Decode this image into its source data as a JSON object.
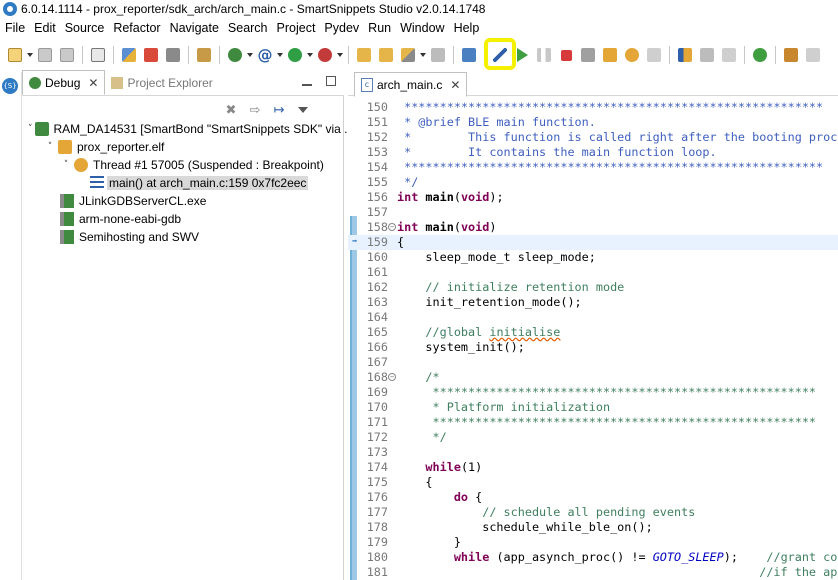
{
  "window": {
    "title": "6.0.14.1114 - prox_reporter/sdk_arch/arch_main.c - SmartSnippets Studio v2.0.14.1748"
  },
  "menu": [
    "File",
    "Edit",
    "Source",
    "Refactor",
    "Navigate",
    "Search",
    "Project",
    "Pydev",
    "Run",
    "Window",
    "Help"
  ],
  "colors": {
    "highlight": "#f5f000",
    "accent": "#2e7bc4",
    "comment": "#3f7f5f",
    "keyword": "#7f0055",
    "current_line": "#e8f2fe"
  },
  "debug_panel": {
    "tabs": [
      {
        "label": "Debug",
        "icon": "debug-icon",
        "active": true
      },
      {
        "label": "Project Explorer",
        "icon": "project-explorer-icon",
        "active": false
      }
    ],
    "tree": [
      {
        "label": "RAM_DA14531 [SmartBond \"SmartSnippets SDK\" via ...",
        "icon": "debug-launch-icon",
        "depth": 0,
        "expanded": true
      },
      {
        "label": "prox_reporter.elf",
        "icon": "elf-file-icon",
        "depth": 1,
        "expanded": true
      },
      {
        "label": "Thread #1 57005 (Suspended : Breakpoint)",
        "icon": "thread-icon",
        "depth": 2,
        "expanded": true
      },
      {
        "label": "main() at arch_main.c:159 0x7fc2eec",
        "icon": "stack-frame-icon",
        "depth": 3,
        "selected": true
      },
      {
        "label": "JLinkGDBServerCL.exe",
        "icon": "process-icon",
        "depth": 1
      },
      {
        "label": "arm-none-eabi-gdb",
        "icon": "process-icon",
        "depth": 1
      },
      {
        "label": "Semihosting and SWV",
        "icon": "process-icon",
        "depth": 1
      }
    ]
  },
  "editor": {
    "tab_label": "arch_main.c",
    "lines": [
      {
        "n": "150",
        "text": " ***********************************************************",
        "cls": "c-doc"
      },
      {
        "n": "151",
        "text": " * @brief BLE main function.",
        "cls": "c-doc"
      },
      {
        "n": "152",
        "text": " *        This function is called right after the booting proce",
        "cls": "c-doc"
      },
      {
        "n": "153",
        "text": " *        It contains the main function loop.",
        "cls": "c-doc"
      },
      {
        "n": "154",
        "text": " ***********************************************************",
        "cls": "c-doc"
      },
      {
        "n": "155",
        "text": " */",
        "cls": "c-doc"
      },
      {
        "n": "156",
        "kw": "int",
        "fn": " main",
        "rest": "(",
        "kw2": "void",
        "tail": ");"
      },
      {
        "n": "157",
        "text": ""
      },
      {
        "n": "158",
        "kw": "int",
        "fn": " main",
        "rest": "(",
        "kw2": "void",
        "tail": ")",
        "fold": true
      },
      {
        "n": "159",
        "text": "{",
        "current": true,
        "mark": true
      },
      {
        "n": "160",
        "text": "    sleep_mode_t sleep_mode;"
      },
      {
        "n": "161",
        "text": ""
      },
      {
        "n": "162",
        "text": "    // initialize retention mode",
        "cls": "c-comment"
      },
      {
        "n": "163",
        "text": "    init_retention_mode();"
      },
      {
        "n": "164",
        "text": ""
      },
      {
        "n": "165",
        "pre": "    //global ",
        "sq": "initialise",
        "cls": "c-comment"
      },
      {
        "n": "166",
        "text": "    system_init();"
      },
      {
        "n": "167",
        "text": ""
      },
      {
        "n": "168",
        "text": "    /*",
        "cls": "c-comment",
        "fold": true
      },
      {
        "n": "169",
        "text": "     ******************************************************",
        "cls": "c-comment"
      },
      {
        "n": "170",
        "text": "     * Platform initialization",
        "cls": "c-comment"
      },
      {
        "n": "171",
        "text": "     ******************************************************",
        "cls": "c-comment"
      },
      {
        "n": "172",
        "text": "     */",
        "cls": "c-comment"
      },
      {
        "n": "173",
        "text": ""
      },
      {
        "n": "174",
        "kwline": "    ",
        "kw": "while",
        "tail": "(1)"
      },
      {
        "n": "175",
        "text": "    {"
      },
      {
        "n": "176",
        "kwline": "        ",
        "kw": "do",
        "tail": " {"
      },
      {
        "n": "177",
        "text": "            // schedule all pending events",
        "cls": "c-comment"
      },
      {
        "n": "178",
        "text": "            schedule_while_ble_on();"
      },
      {
        "n": "179",
        "text": "        }"
      },
      {
        "n": "180",
        "kwline": "        ",
        "kw": "while",
        "tail": " (app_asynch_proc() != ",
        "macro": "GOTO_SLEEP",
        "tail2": ");    ",
        "comment": "//grant con"
      },
      {
        "n": "181",
        "text": "                                                   //if the ap",
        "cls": "c-comment"
      }
    ]
  }
}
